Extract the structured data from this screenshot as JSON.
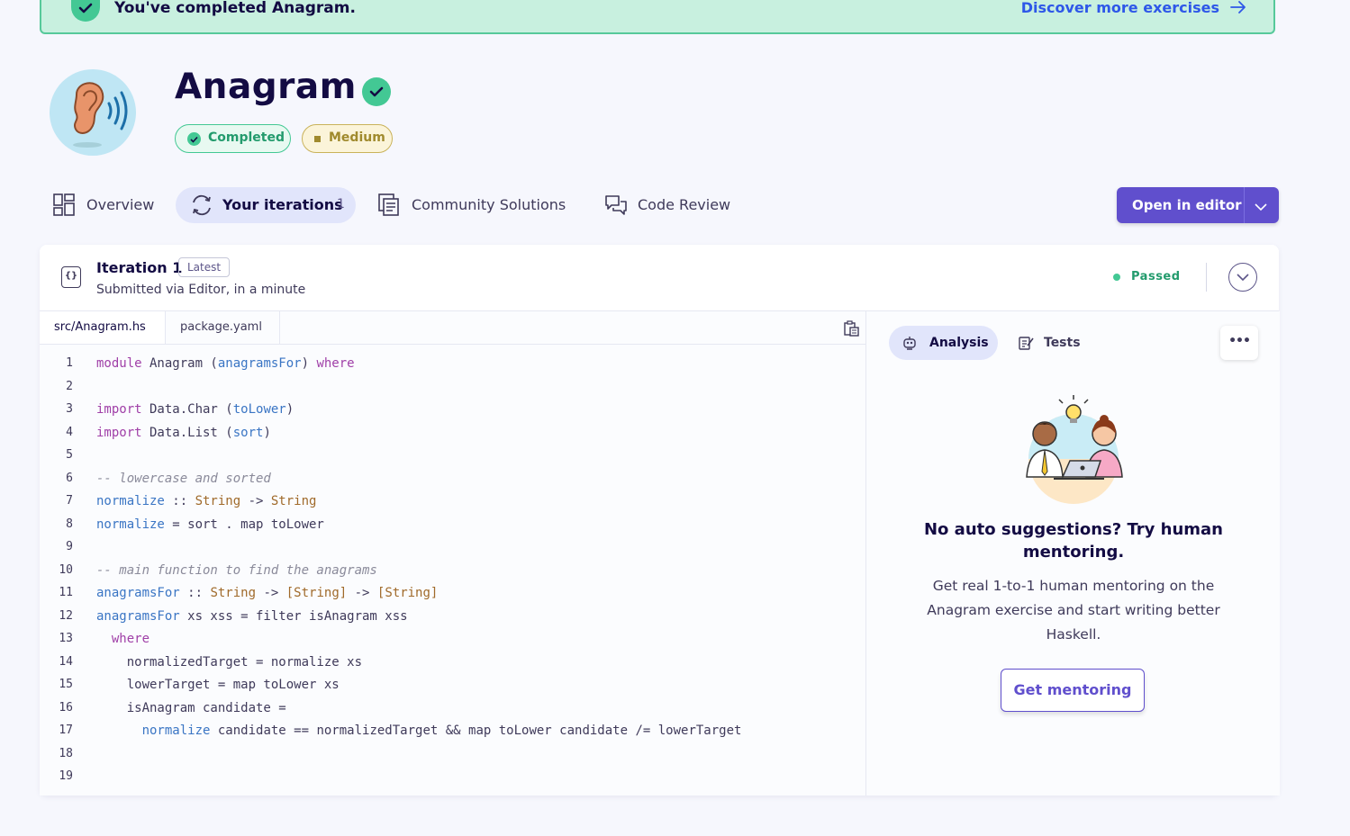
{
  "banner": {
    "message": "You've completed Anagram.",
    "link_label": "Discover more exercises"
  },
  "exercise": {
    "title": "Anagram",
    "status_tag": "Completed",
    "difficulty_tag": "Medium"
  },
  "tabs": [
    {
      "label": "Overview"
    },
    {
      "label": "Your iterations",
      "count": "1"
    },
    {
      "label": "Community Solutions"
    },
    {
      "label": "Code Review"
    }
  ],
  "open_editor": {
    "label": "Open in editor"
  },
  "iteration": {
    "title": "Iteration 1",
    "badge": "Latest",
    "submitted": "Submitted via Editor, in a minute",
    "status": "Passed"
  },
  "files": [
    "src/Anagram.hs",
    "package.yaml"
  ],
  "code_lines": [
    "module Anagram (anagramsFor) where",
    "",
    "import Data.Char (toLower)",
    "import Data.List (sort)",
    "",
    "-- lowercase and sorted",
    "normalize :: String -> String",
    "normalize = sort . map toLower",
    "",
    "-- main function to find the anagrams",
    "anagramsFor :: String -> [String] -> [String]",
    "anagramsFor xs xss = filter isAnagram xss",
    "  where",
    "    normalizedTarget = normalize xs",
    "    lowerTarget = map toLower xs",
    "    isAnagram candidate =",
    "      normalize candidate == normalizedTarget && map toLower candidate /= lowerTarget",
    "",
    ""
  ],
  "side_panel": {
    "tab_analysis": "Analysis",
    "tab_tests": "Tests",
    "more": "•••",
    "title": "No auto suggestions? Try human mentoring.",
    "text": "Get real 1-to-1 human mentoring on the Anagram exercise and start writing better Haskell.",
    "button": "Get mentoring"
  },
  "colors": {
    "accent": "#604fcd",
    "success": "#43c894",
    "banner_bg": "#c8f0df",
    "link": "#2e57e8"
  }
}
